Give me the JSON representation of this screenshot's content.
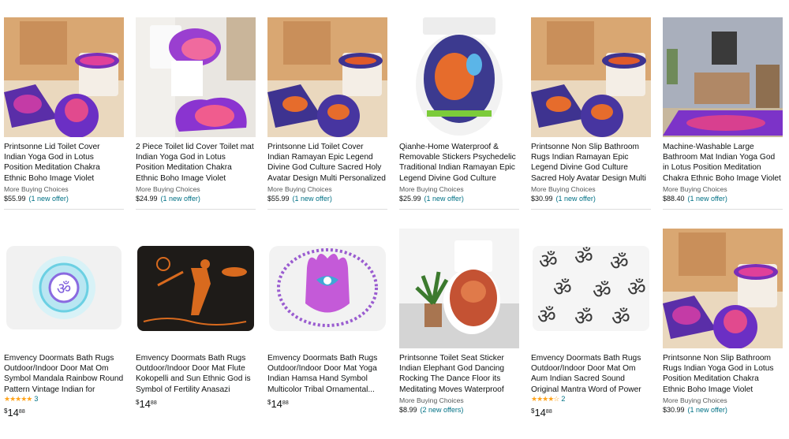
{
  "row1": [
    {
      "title": "Printsonne Lid Toilet Cover Indian Yoga God in Lotus Position Meditation Chakra Ethnic Boho Image Violet Fuchsia Personalized...",
      "mbc": "More Buying Choices",
      "price": "$55.99",
      "offer": "(1 new offer)",
      "image": "bathroom-rug-set-yoga-icon"
    },
    {
      "title": "2 Piece Toilet lid Cover Toilet mat Indian Yoga God in Lotus Position Meditation Chakra Ethnic Boho Image Violet Fuchsia High Density...",
      "mbc": "More Buying Choices",
      "price": "$24.99",
      "offer": "(1 new offer)",
      "image": "toilet-mat-set-icon"
    },
    {
      "title": "Printsonne Lid Toilet Cover Indian Ramayan Epic Legend Divine God Culture Sacred Holy Avatar Design Multi Personalized Durable",
      "mbc": "More Buying Choices",
      "price": "$55.99",
      "offer": "(1 new offer)",
      "image": "bathroom-rug-set-ramayan-icon"
    },
    {
      "title": "Qianhe-Home Waterproof & Removable Stickers Psychedelic Traditional Indian Ramayan Epic Legend Divine God Culture Sacred...",
      "mbc": "More Buying Choices",
      "price": "$25.99",
      "offer": "(1 new offer)",
      "image": "toilet-sticker-icon"
    },
    {
      "title": "Printsonne Non Slip Bathroom Rugs Indian Ramayan Epic Legend Divine God Culture Sacred Holy Avatar Design Multi Absorbent Cover",
      "mbc": "More Buying Choices",
      "price": "$30.99",
      "offer": "(1 new offer)",
      "image": "bathroom-rug-set-ramayan-icon"
    },
    {
      "title": "Machine-Washable Large Bathroom Mat Indian Yoga God in Lotus Position Meditation Chakra Ethnic Boho Image Violet Fuchsia...",
      "mbc": "More Buying Choices",
      "price": "$88.40",
      "offer": "(1 new offer)",
      "image": "room-rug-icon"
    }
  ],
  "row2": [
    {
      "title": "Emvency Doormats Bath Rugs Outdoor/Indoor Door Mat Om Symbol Mandala Rainbow Round Pattern Vintage Indian for Tattoo...",
      "stars": "★★★★★",
      "rating_count": "3",
      "cur": "$",
      "whole": "14",
      "frac": "88",
      "image": "om-mandala-mat-icon"
    },
    {
      "title": "Emvency Doormats Bath Rugs Outdoor/Indoor Door Mat Flute Kokopelli and Sun Ethnic God is Symbol of Fertility Anasazi Player...",
      "cur": "$",
      "whole": "14",
      "frac": "88",
      "image": "kokopelli-mat-icon"
    },
    {
      "title": "Emvency Doormats Bath Rugs Outdoor/Indoor Door Mat Yoga Indian Hamsa Hand Symbol Multicolor Tribal Ornamental...",
      "cur": "$",
      "whole": "14",
      "frac": "88",
      "image": "hamsa-mat-icon"
    },
    {
      "title": "Printsonne Toilet Seat Sticker Indian Elephant God Dancing Rocking The Dance Floor its Meditating Moves Waterproof Decorative Toilet Cove...",
      "mbc": "More Buying Choices",
      "price": "$8.99",
      "offer": "(2 new offers)",
      "image": "toilet-seat-sticker-icon"
    },
    {
      "title": "Emvency Doormats Bath Rugs Outdoor/Indoor Door Mat Om Aum Indian Sacred Sound Original Mantra Word of Power The Symbo...",
      "stars": "★★★★☆",
      "rating_count": "2",
      "cur": "$",
      "whole": "14",
      "frac": "88",
      "image": "om-pattern-mat-icon"
    },
    {
      "title": "Printsonne Non Slip Bathroom Rugs Indian Yoga God in Lotus Position Meditation Chakra Ethnic Boho Image Violet Fuchsia Absorbent...",
      "mbc": "More Buying Choices",
      "price": "$30.99",
      "offer": "(1 new offer)",
      "image": "bathroom-rug-set-yoga-icon"
    }
  ]
}
